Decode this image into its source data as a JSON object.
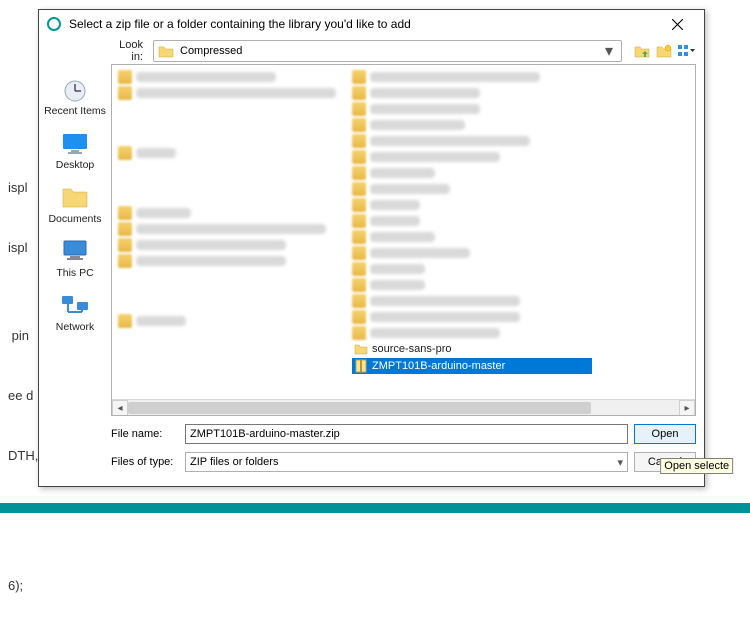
{
  "dialog": {
    "title": "Select a zip file or a folder containing the library you'd like to add",
    "lookin_label": "Look in:",
    "lookin_value": "Compressed"
  },
  "places": [
    {
      "id": "recent",
      "label": "Recent Items"
    },
    {
      "id": "desktop",
      "label": "Desktop"
    },
    {
      "id": "documents",
      "label": "Documents"
    },
    {
      "id": "thispc",
      "label": "This PC"
    },
    {
      "id": "network",
      "label": "Network"
    }
  ],
  "list": {
    "visible_items": [
      {
        "name": "source-sans-pro",
        "selected": false
      },
      {
        "name": "ZMPT101B-arduino-master",
        "selected": true
      }
    ]
  },
  "filename_label": "File name:",
  "filename_value": "ZMPT101B-arduino-master.zip",
  "filetype_label": "Files of type:",
  "filetype_value": "ZIP files or folders",
  "buttons": {
    "open": "Open",
    "cancel": "Cancel"
  },
  "tooltip": "Open selecte",
  "code_behind": {
    "l1": "ispl",
    "l2": "ispl",
    "l3": " pin",
    "l4": "ee d",
    "l5": "DTH,",
    "l6": "6);"
  }
}
